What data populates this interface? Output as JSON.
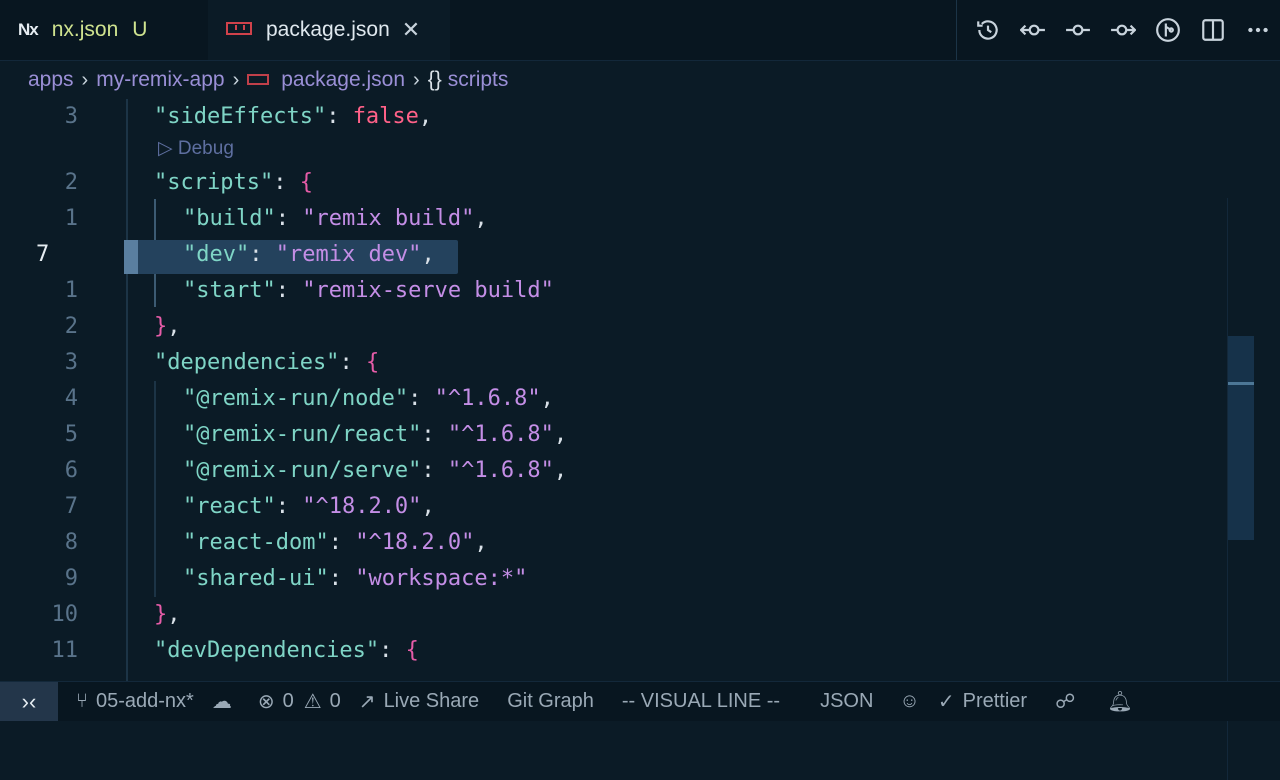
{
  "tabs": {
    "nx": {
      "logo": "Nx",
      "label": "nx.json",
      "status": "U"
    },
    "pkg": {
      "label": "package.json",
      "close": "✕"
    }
  },
  "breadcrumb": {
    "items": [
      "apps",
      "my-remix-app",
      "package.json",
      "scripts"
    ],
    "braces": "{}"
  },
  "editor": {
    "codelens": "▷ Debug",
    "active_line": "7",
    "line_numbers": [
      "3",
      "2",
      "1",
      "7",
      "1",
      "2",
      "3",
      "4",
      "5",
      "6",
      "7",
      "8",
      "9",
      "10",
      "11"
    ],
    "lines": [
      {
        "indent": "  ",
        "key": "\"sideEffects\"",
        "sep": ": ",
        "val": "false",
        "end": ","
      },
      {
        "indent": "  ",
        "key": "\"scripts\"",
        "sep": ": ",
        "val": "{",
        "end": ""
      },
      {
        "indent": "    ",
        "key": "\"build\"",
        "sep": ": ",
        "val": "\"remix build\"",
        "end": ","
      },
      {
        "indent": "    ",
        "key": "\"dev\"",
        "sep": ": ",
        "val": "\"remix dev\"",
        "end": ","
      },
      {
        "indent": "    ",
        "key": "\"start\"",
        "sep": ": ",
        "val": "\"remix-serve build\"",
        "end": ""
      },
      {
        "indent": "  ",
        "key": "",
        "sep": "",
        "val": "}",
        "end": ","
      },
      {
        "indent": "  ",
        "key": "\"dependencies\"",
        "sep": ": ",
        "val": "{",
        "end": ""
      },
      {
        "indent": "    ",
        "key": "\"@remix-run/node\"",
        "sep": ": ",
        "val": "\"^1.6.8\"",
        "end": ","
      },
      {
        "indent": "    ",
        "key": "\"@remix-run/react\"",
        "sep": ": ",
        "val": "\"^1.6.8\"",
        "end": ","
      },
      {
        "indent": "    ",
        "key": "\"@remix-run/serve\"",
        "sep": ": ",
        "val": "\"^1.6.8\"",
        "end": ","
      },
      {
        "indent": "    ",
        "key": "\"react\"",
        "sep": ": ",
        "val": "\"^18.2.0\"",
        "end": ","
      },
      {
        "indent": "    ",
        "key": "\"react-dom\"",
        "sep": ": ",
        "val": "\"^18.2.0\"",
        "end": ","
      },
      {
        "indent": "    ",
        "key": "\"shared-ui\"",
        "sep": ": ",
        "val": "\"workspace:*\"",
        "end": ""
      },
      {
        "indent": "  ",
        "key": "",
        "sep": "",
        "val": "}",
        "end": ","
      },
      {
        "indent": "  ",
        "key": "\"devDependencies\"",
        "sep": ": ",
        "val": "{",
        "end": ""
      }
    ]
  },
  "statusbar": {
    "remote_icon": "remote-icon",
    "branch": "05-add-nx*",
    "errors": "0",
    "warnings": "0",
    "live_share": "Live Share",
    "git_graph": "Git Graph",
    "mode": "-- VISUAL LINE --",
    "language": "JSON",
    "prettier": "Prettier"
  },
  "colors": {
    "background": "#0b1b26",
    "key": "#7fd5c6",
    "string": "#c48ee6",
    "boolean": "#ff6188",
    "bracket": "#e65ca8"
  }
}
